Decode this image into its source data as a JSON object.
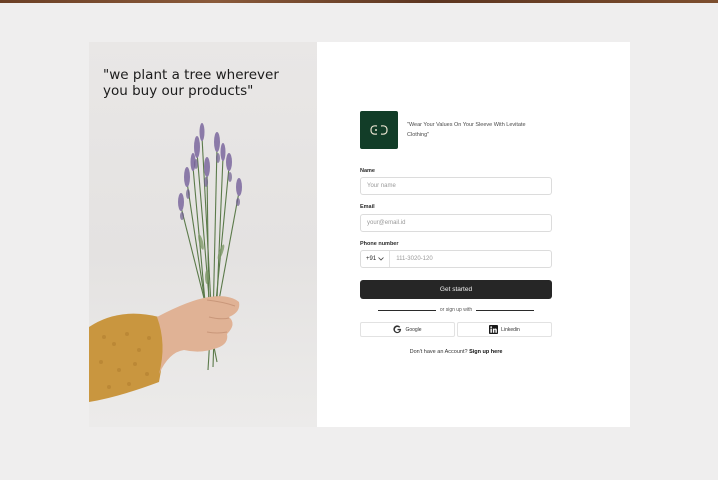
{
  "quote": "\"we plant a tree wherever you buy our products\"",
  "brand": {
    "tagline": "\"Wear Your Values On Your Sleeve With Levitate Clothing\""
  },
  "form": {
    "name_label": "Name",
    "name_placeholder": "Your name",
    "email_label": "Email",
    "email_placeholder": "your@email.id",
    "phone_label": "Phone number",
    "country_code": "+91",
    "phone_placeholder": "111-3020-120",
    "submit_label": "Get started"
  },
  "divider_text": "or sign up with",
  "social": {
    "google_label": "Google",
    "linkedin_label": "Linkedin"
  },
  "signup": {
    "prompt": "Don't have an Account?",
    "link": "Sign up here"
  },
  "colors": {
    "page_bg": "#efeeee",
    "logo_bg": "#123d28",
    "cta_bg": "#262626"
  },
  "icons": [
    "leaf-logo-icon",
    "chevron-down-icon",
    "google-icon",
    "linkedin-icon"
  ]
}
